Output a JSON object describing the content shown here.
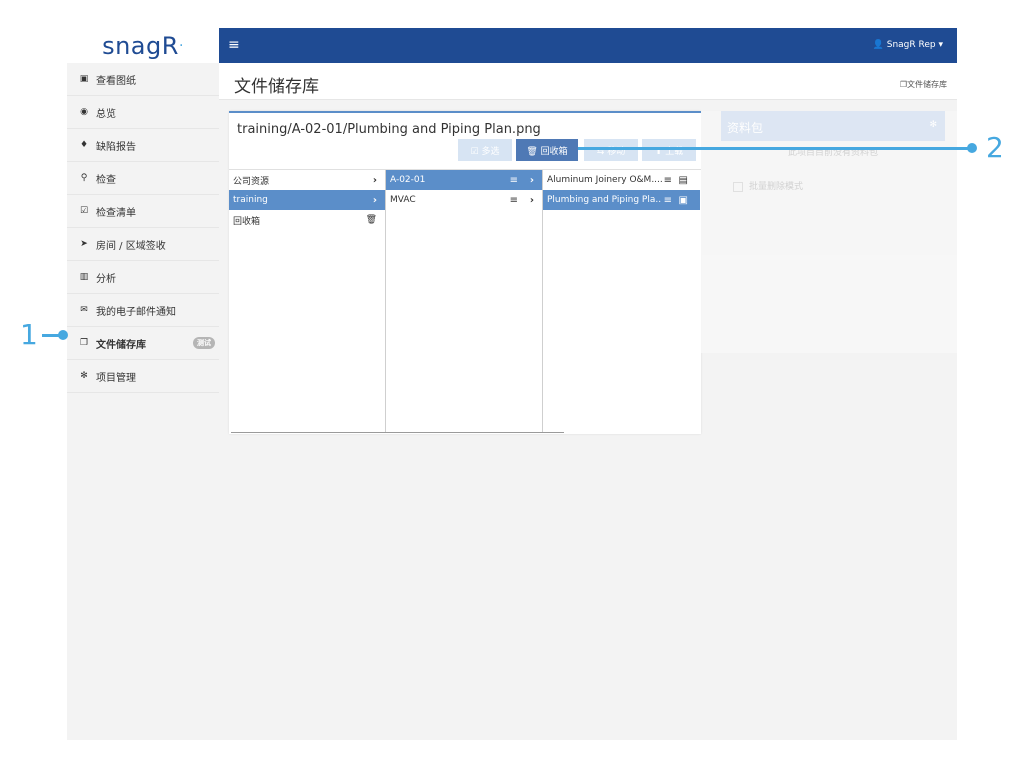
{
  "app": {
    "logo": "snagR",
    "logo_mark": "·",
    "user_label": "SnagR Rep ▾"
  },
  "sidebar": {
    "items": [
      {
        "icon": "image-icon",
        "glyph": "▣",
        "label": "查看图纸"
      },
      {
        "icon": "dashboard-icon",
        "glyph": "◉",
        "label": "总览"
      },
      {
        "icon": "map-marker-icon",
        "glyph": "♦",
        "label": "缺陷报告"
      },
      {
        "icon": "search-icon",
        "glyph": "⚲",
        "label": "检查"
      },
      {
        "icon": "checklist-icon",
        "glyph": "☑",
        "label": "检查清单"
      },
      {
        "icon": "location-arrow-icon",
        "glyph": "➤",
        "label": "房间 / 区域签收"
      },
      {
        "icon": "bar-chart-icon",
        "glyph": "▥",
        "label": "分析"
      },
      {
        "icon": "envelope-icon",
        "glyph": "✉",
        "label": "我的电子邮件通知"
      },
      {
        "icon": "copy-icon",
        "glyph": "❐",
        "label": "文件储存库",
        "badge": "测试"
      },
      {
        "icon": "cogs-icon",
        "glyph": "✻",
        "label": "项目管理"
      }
    ]
  },
  "page": {
    "title": "文件储存库",
    "breadcrumb": "文件储存库"
  },
  "browser": {
    "file_path": "training/A-02-01/Plumbing and Piping Plan.png",
    "buttons": {
      "multi_select": "☑ 多选",
      "recycle_bin": "🗑 回收箱",
      "move": "⇆ 移动",
      "upload": "⬆ 上载"
    },
    "col1": [
      {
        "label": "公司资源",
        "action": "›"
      },
      {
        "label": "training",
        "action": "›"
      },
      {
        "label": "回收箱",
        "action": "🗑"
      }
    ],
    "col2": [
      {
        "label": "A-02-01",
        "menu": "≡",
        "action": "›"
      },
      {
        "label": "MVAC",
        "menu": "≡",
        "action": "›"
      }
    ],
    "col3": [
      {
        "label": "Aluminum Joinery O&M....",
        "menu": "≡",
        "action": "▤"
      },
      {
        "label": "Plumbing and Piping Pla...",
        "menu": "≡",
        "action": "▣"
      }
    ]
  },
  "package_panel": {
    "title": "资料包",
    "empty_text": "此项目目前没有资料包",
    "bulk_delete": "批量删除模式"
  },
  "callouts": [
    "1",
    "2"
  ],
  "colors": {
    "brand": "#1f4b93",
    "selected": "#5b8ec9",
    "callout": "#46a8e0"
  }
}
